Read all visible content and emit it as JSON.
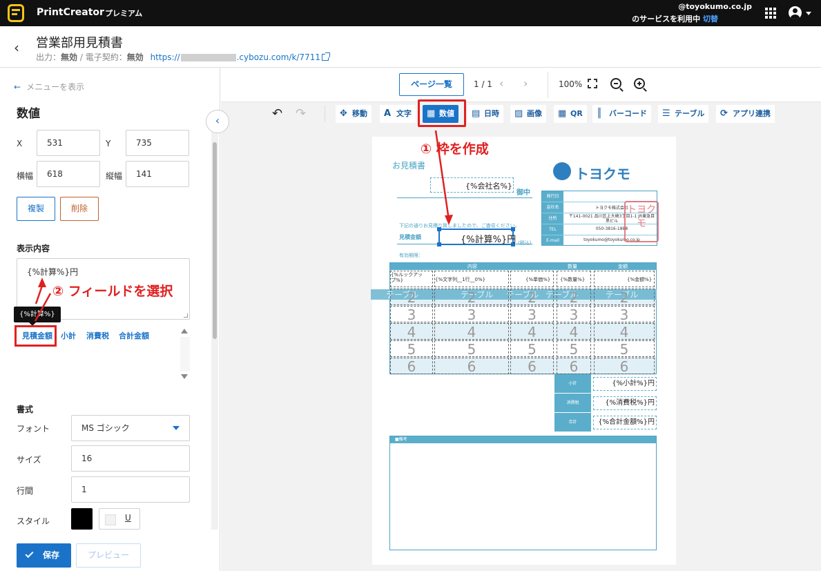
{
  "topbar": {
    "app_name": "PrintCreator",
    "plan": "プレミアム",
    "account_email": "@toyokumo.co.jp",
    "service_text": "のサービスを利用中",
    "switch_label": "切替"
  },
  "header": {
    "back": "‹",
    "title": "営業部用見積書",
    "output_label": "出力：",
    "output_value": "無効",
    "contract_label": " / 電子契約：",
    "contract_value": "無効",
    "link_prefix": "https://",
    "link_suffix": ".cybozu.com/k/7711"
  },
  "left_panel": {
    "menu_toggle": "メニューを表示",
    "title": "数値",
    "x_label": "X",
    "x_value": "531",
    "y_label": "Y",
    "y_value": "735",
    "width_label": "横幅",
    "width_value": "618",
    "height_label": "縦幅",
    "height_value": "141",
    "duplicate_label": "複製",
    "delete_label": "削除",
    "content_heading": "表示内容",
    "content_value": "{%計算%}円",
    "tooltip": "{%計算%}",
    "field_chips": [
      "見積金額",
      "小計",
      "消費税",
      "合計金額"
    ],
    "format_heading": "書式",
    "font_label": "フォント",
    "font_value": "MS ゴシック",
    "size_label": "サイズ",
    "size_value": "16",
    "line_label": "行間",
    "line_value": "1",
    "style_label": "スタイル",
    "underline_label": "U",
    "save_label": "保存",
    "preview_label": "プレビュー"
  },
  "annotations": {
    "step1": "① 枠を作成",
    "step2": "② フィールドを選択"
  },
  "canvas": {
    "pages_button": "ページ一覧",
    "page_count": "1 / 1",
    "zoom": "100%",
    "tools": [
      {
        "icon": "✥",
        "label": "移動"
      },
      {
        "icon": "A",
        "label": "文字"
      },
      {
        "icon": "▦",
        "label": "数値"
      },
      {
        "icon": "▤",
        "label": "日時"
      },
      {
        "icon": "▨",
        "label": "画像"
      },
      {
        "icon": "▦",
        "label": "QR"
      },
      {
        "icon": "║",
        "label": "バーコード"
      },
      {
        "icon": "☰",
        "label": "テーブル"
      },
      {
        "icon": "⟳",
        "label": "アプリ連携"
      }
    ]
  },
  "document": {
    "heading": "お見積書",
    "company_field": "{%会社名%}",
    "honorific": "御中",
    "intro": "下記の通りお見積り致しましたので、ご査収ください。",
    "amount_label": "見積金額",
    "amount_field": "{%計算%}円",
    "tax_note": "(税込)",
    "valid_label": "有効期限：",
    "brand": "トヨクモ",
    "info": [
      {
        "k": "発行日",
        "v": ""
      },
      {
        "k": "会社名",
        "v": "トヨクモ株式会社"
      },
      {
        "k": "住所",
        "v": "〒141-0021 品川区上大崎3丁目1-1 JR東急目黒ビル"
      },
      {
        "k": "TEL",
        "v": "050-3816-1888"
      },
      {
        "k": "E-mail",
        "v": "toyokumo@toyokumo.co.jp"
      }
    ],
    "stamp": "トヨクモ",
    "table_headers": [
      "内容",
      "数量",
      "金額"
    ],
    "row1": [
      "{%ルックアップ%}",
      "{%文字列__1行__0%}",
      "{%単価%}",
      "{%数量%}",
      "{%金額%}"
    ],
    "band_label": "テーブル",
    "row_numbers": [
      "2",
      "3",
      "4",
      "5",
      "6"
    ],
    "totals": [
      {
        "k": "小計",
        "v": "{%小計%}円"
      },
      {
        "k": "消費税",
        "v": "{%消費税%}円"
      },
      {
        "k": "合計",
        "v": "{%合計金額%}円"
      }
    ],
    "memo_heading": "■備考"
  }
}
